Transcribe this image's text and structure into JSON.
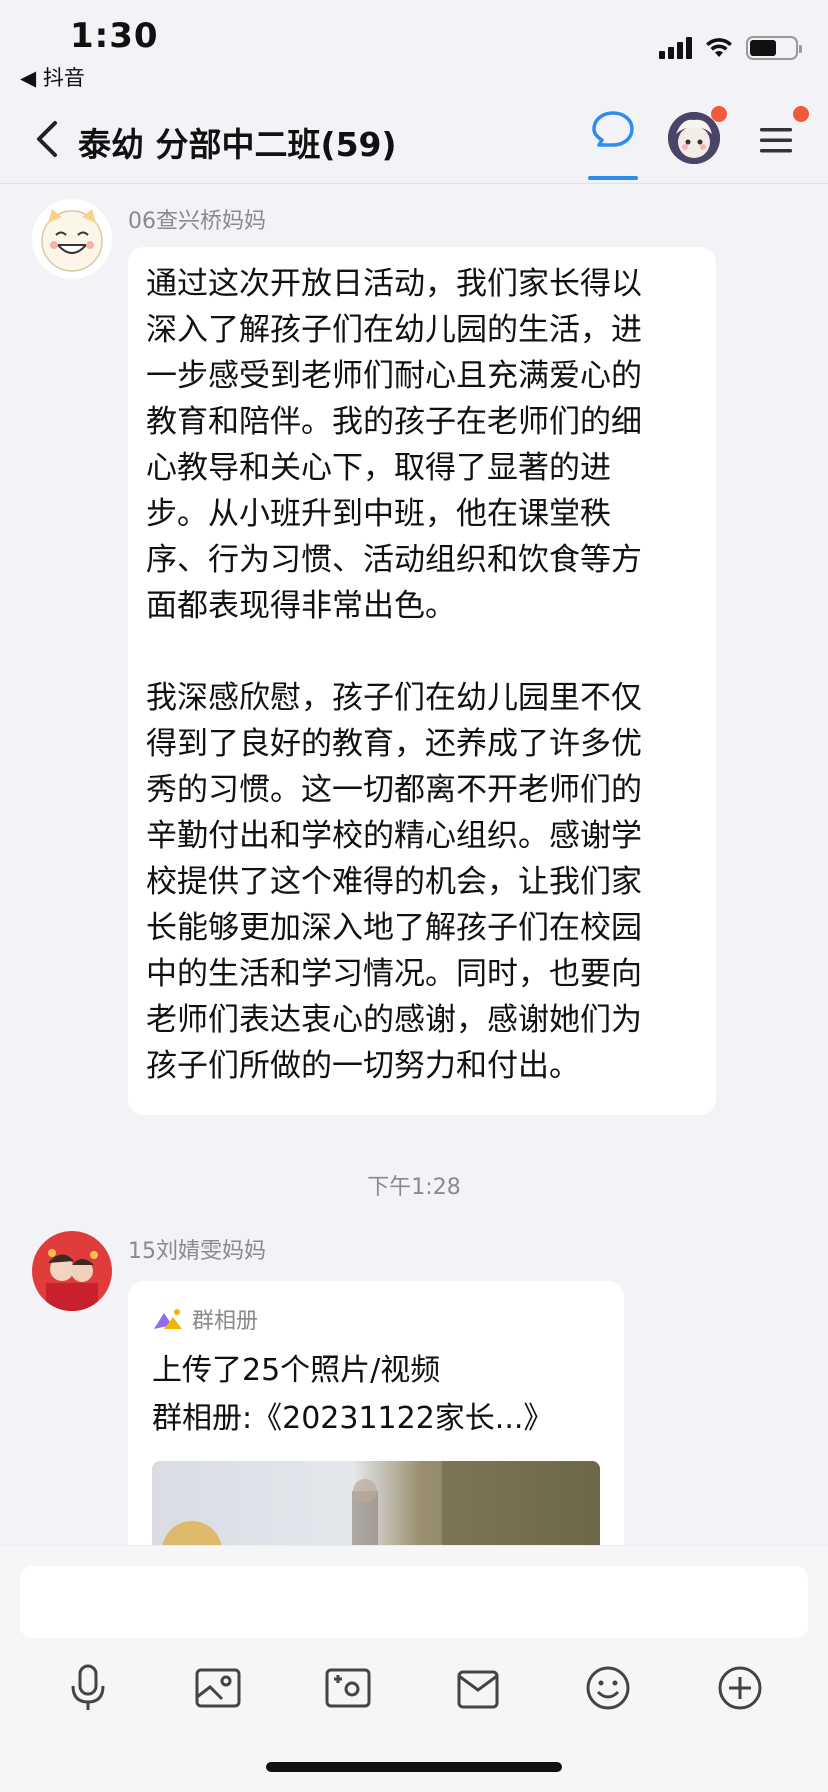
{
  "status_bar": {
    "time": "1:30",
    "back_app": "◀ 抖音",
    "battery_level": 0.6
  },
  "nav": {
    "title": "泰幼 分部中二班(59)"
  },
  "messages": [
    {
      "sender": "06查兴桥妈妈",
      "text": "通过这次开放日活动，我们家长得以\n深入了解孩子们在幼儿园的生活，进\n一步感受到老师们耐心且充满爱心的\n教育和陪伴。我的孩子在老师们的细\n心教导和关心下，取得了显著的进\n步。从小班升到中班，他在课堂秩\n序、行为习惯、活动组织和饮食等方\n面都表现得非常出色。\n\n我深感欣慰，孩子们在幼儿园里不仅\n得到了良好的教育，还养成了许多优\n秀的习惯。这一切都离不开老师们的\n辛勤付出和学校的精心组织。感谢学\n校提供了这个难得的机会，让我们家\n长能够更加深入地了解孩子们在校园\n中的生活和学习情况。同时，也要向\n老师们表达衷心的感谢，感谢她们为\n孩子们所做的一切努力和付出。"
    },
    {
      "sender": "15刘婧雯妈妈",
      "album": {
        "label": "群相册",
        "line1": "上传了25个照片/视频",
        "line2": "群相册:《20231122家长...》"
      }
    }
  ],
  "timestamp": "下午1:28",
  "colors": {
    "accent": "#2d8cf0",
    "badge": "#f25a3a",
    "background": "#f2f2f7"
  },
  "toolbar_icons": [
    "microphone-icon",
    "image-icon",
    "camera-icon",
    "folder-icon",
    "emoji-icon",
    "plus-icon"
  ]
}
